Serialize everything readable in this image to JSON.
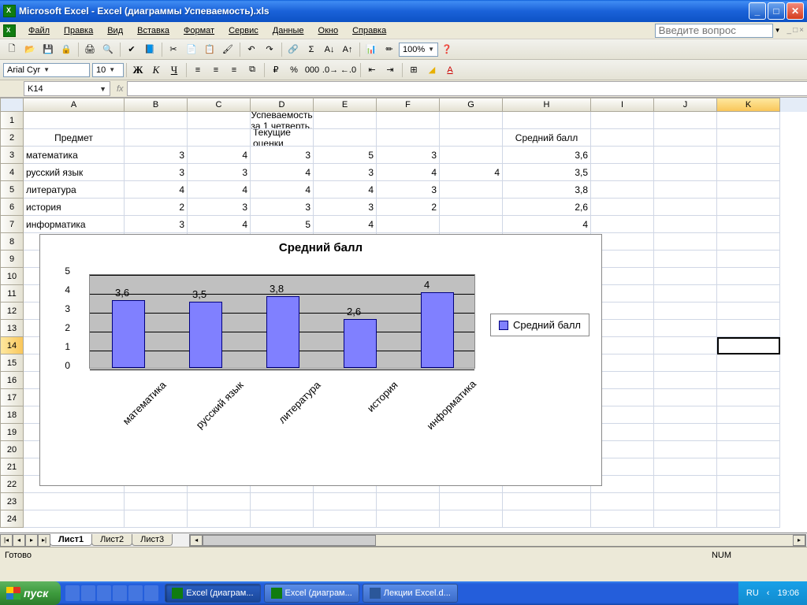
{
  "window": {
    "title": "Microsoft Excel - Excel (диаграммы Успеваемость).xls",
    "question_placeholder": "Введите вопрос"
  },
  "menu": {
    "file": "Файл",
    "edit": "Правка",
    "view": "Вид",
    "insert": "Вставка",
    "format": "Формат",
    "tools": "Сервис",
    "data": "Данные",
    "window": "Окно",
    "help": "Справка"
  },
  "toolbar": {
    "zoom": "100%"
  },
  "format_bar": {
    "font_name": "Arial Cyr",
    "font_size": "10"
  },
  "namebox": "K14",
  "cols": [
    "A",
    "B",
    "C",
    "D",
    "E",
    "F",
    "G",
    "H",
    "I",
    "J",
    "K"
  ],
  "sheet": {
    "title_row": "Успеваемость за 1 четверть.",
    "headers": {
      "subject": "Предмет",
      "current": "Текущие оценки",
      "avg": "Средний балл"
    },
    "rows": [
      {
        "n": "3",
        "subject": "математика",
        "g": [
          "3",
          "4",
          "3",
          "5",
          "3",
          ""
        ],
        "avg": "3,6"
      },
      {
        "n": "4",
        "subject": "русский язык",
        "g": [
          "3",
          "3",
          "4",
          "3",
          "4",
          "4"
        ],
        "avg": "3,5"
      },
      {
        "n": "5",
        "subject": "литература",
        "g": [
          "4",
          "4",
          "4",
          "4",
          "3",
          ""
        ],
        "avg": "3,8"
      },
      {
        "n": "6",
        "subject": "история",
        "g": [
          "2",
          "3",
          "3",
          "3",
          "2",
          ""
        ],
        "avg": "2,6"
      },
      {
        "n": "7",
        "subject": "информатика",
        "g": [
          "3",
          "4",
          "5",
          "4",
          "",
          ""
        ],
        "avg": "4"
      }
    ]
  },
  "chart_data": {
    "type": "bar",
    "title": "Средний балл",
    "categories": [
      "математика",
      "русский язык",
      "литература",
      "история",
      "информатика"
    ],
    "values": [
      3.6,
      3.5,
      3.8,
      2.6,
      4
    ],
    "labels": [
      "3,6",
      "3,5",
      "3,8",
      "2,6",
      "4"
    ],
    "yticks": [
      "0",
      "1",
      "2",
      "3",
      "4",
      "5"
    ],
    "ylim": [
      0,
      5
    ],
    "legend": "Средний балл"
  },
  "tabs": {
    "t1": "Лист1",
    "t2": "Лист2",
    "t3": "Лист3"
  },
  "statusbar": {
    "ready": "Готово",
    "num": "NUM"
  },
  "taskbar": {
    "start": "пуск",
    "lang": "RU",
    "clock": "19:06",
    "t1": "Excel (диаграм...",
    "t2": "Excel (диаграм...",
    "t3": "Лекции Excel.d..."
  }
}
